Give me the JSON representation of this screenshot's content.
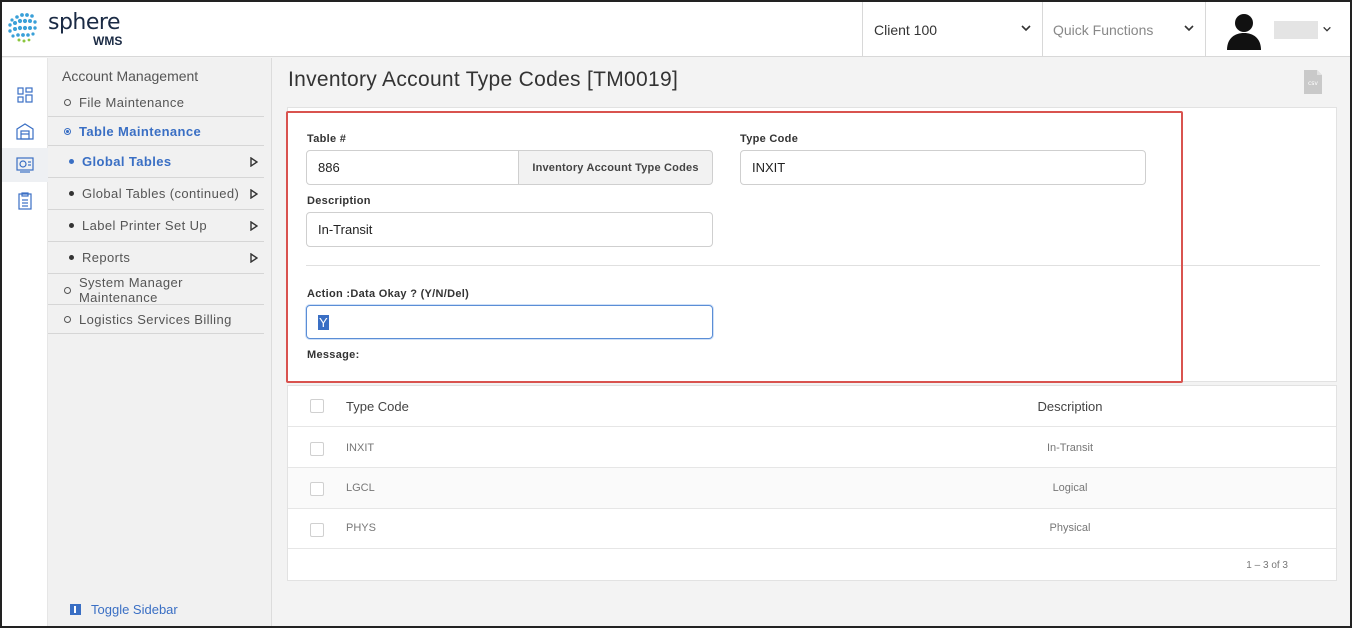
{
  "header": {
    "logo_text": "sphere",
    "logo_sub": "WMS",
    "client_label": "Client 100",
    "quick_label": "Quick Functions"
  },
  "sidebar": {
    "heading": "Account Management",
    "items": [
      {
        "label": "File Maintenance"
      },
      {
        "label": "Table Maintenance"
      },
      {
        "label": "Global Tables"
      },
      {
        "label": "Global Tables (continued)"
      },
      {
        "label": "Label Printer Set Up"
      },
      {
        "label": "Reports"
      },
      {
        "label": "System Manager Maintenance"
      },
      {
        "label": "Logistics Services Billing"
      }
    ],
    "toggle_label": "Toggle Sidebar"
  },
  "main": {
    "title": "Inventory Account Type Codes [TM0019]",
    "form": {
      "table_no_label": "Table #",
      "table_no_value": "886",
      "table_name": "Inventory Account Type Codes",
      "type_code_label": "Type Code",
      "type_code_value": "INXIT",
      "description_label": "Description",
      "description_value": "In-Transit",
      "action_label": "Action :Data Okay ? (Y/N/Del)",
      "action_value": "Y",
      "message_label": "Message:"
    },
    "table": {
      "columns": [
        "Type Code",
        "Description"
      ],
      "rows": [
        {
          "code": "INXIT",
          "description": "In-Transit"
        },
        {
          "code": "LGCL",
          "description": "Logical"
        },
        {
          "code": "PHYS",
          "description": "Physical"
        }
      ],
      "pager": "1 – 3 of 3"
    }
  },
  "colors": {
    "accent": "#3a6fc4",
    "highlight_border": "#d9534f"
  }
}
